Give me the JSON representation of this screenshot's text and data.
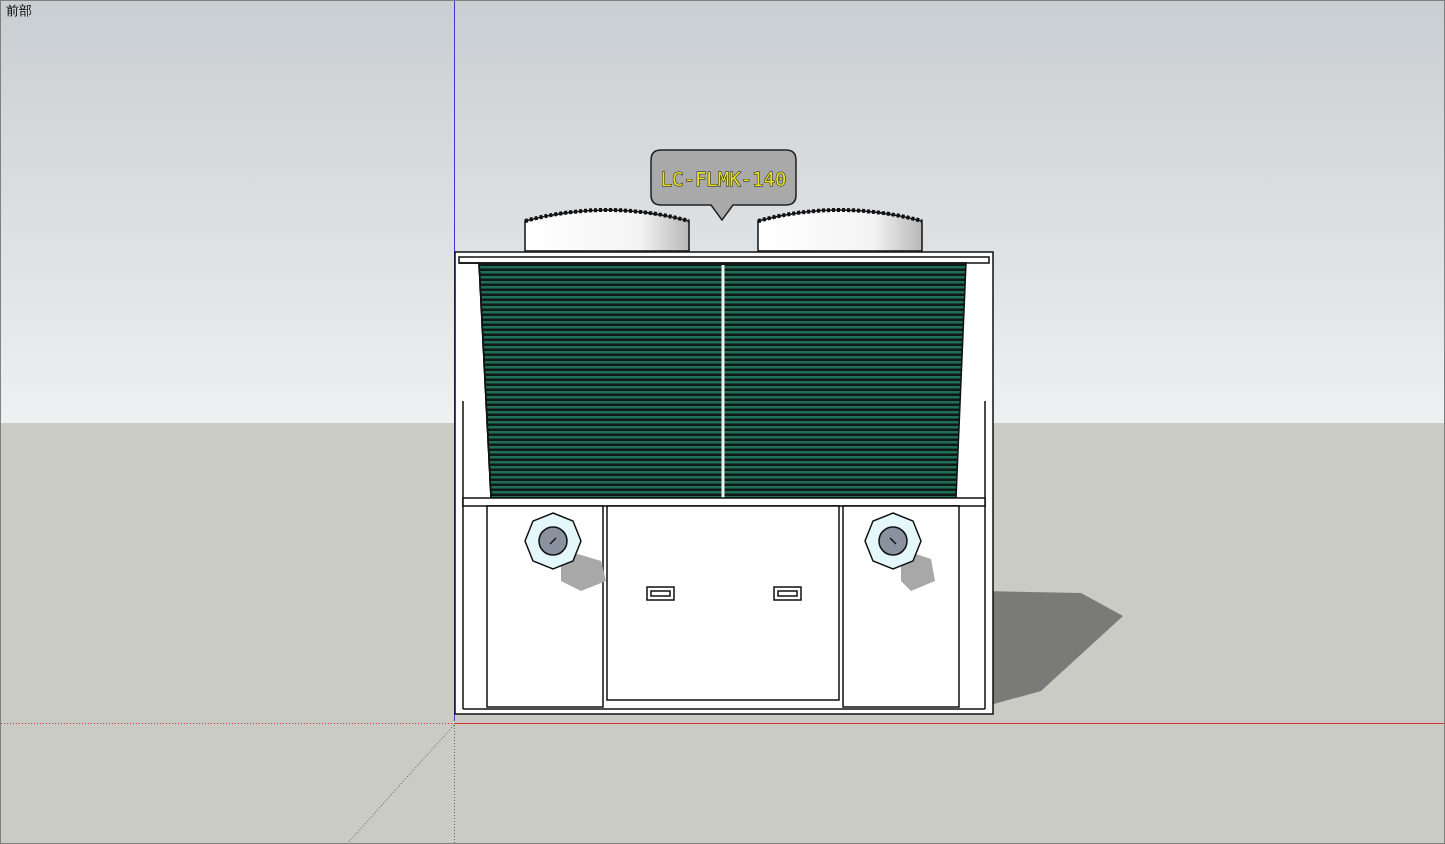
{
  "view_label": "前部",
  "tag": {
    "text": "LC-FLMK-140"
  }
}
